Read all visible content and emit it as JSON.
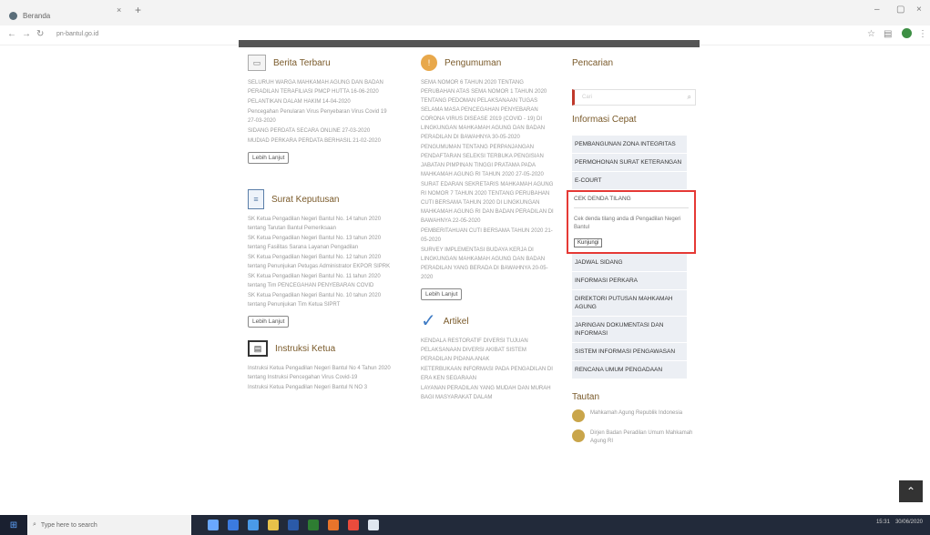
{
  "browser": {
    "tab_title": "Beranda",
    "tab_close": "×",
    "new_tab": "+",
    "url": "pn-bantul.go.id",
    "win_minimize": "–",
    "win_restore": "▢",
    "win_close": "×"
  },
  "berita": {
    "title": "Berita Terbaru",
    "items": [
      "SELURUH WARGA MAHKAMAH AGUNG DAN BADAN PERADILAN TERAFILIASI PMCP HUTTA 16-06-2020",
      "PELANTIKAN DALAM HAKIM 14-04-2020",
      "Pencegahan Penularan Virus Penyebaran Virus Covid 19 27-03-2020",
      "SIDANG PERDATA SECARA ONLINE 27-03-2020",
      "MUDIAD PERKARA PERDATA BERHASIL 21-02-2020"
    ],
    "more": "Lebih Lanjut"
  },
  "putusan": {
    "title": "Surat Keputusan",
    "items": [
      "SK Ketua Pengadilan Negeri Bantul No. 14 tahun 2020 tentang Tarutan Bantul Pemeriksaan",
      "SK Ketua Pengadilan Negeri Bantul No. 13 tahun 2020 tentang Fasilitas Sarana Layanan Pengadilan",
      "SK Ketua Pengadilan Negeri Bantul No. 12 tahun 2020 tentang Penunjukan Petugas Administrator EKPOR SIPRK",
      "SK Ketua Pengadilan Negeri Bantul No. 11 tahun 2020 tentang Tim PENCEGAHAN PENYEBARAN COVID",
      "SK Ketua Pengadilan Negeri Bantul No. 10 tahun 2020 tentang Penunjukan Tim Ketua SIPRT"
    ],
    "more": "Lebih Lanjut"
  },
  "instruksi": {
    "title": "Instruksi Ketua",
    "items": [
      "Instruksi Ketua Pengadilan Negeri Bantul No 4 Tahun 2020 tentang Instruksi Pencegahan Virus Covid-19",
      "Instruksi Ketua Pengadilan Negeri Bantul N NO 3"
    ]
  },
  "pengumuman": {
    "title": "Pengumuman",
    "items": [
      "SEMA NOMOR 6 TAHUN 2020 TENTANG PERUBAHAN ATAS SEMA NOMOR 1 TAHUN 2020 TENTANG PEDOMAN PELAKSANAAN TUGAS SELAMA MASA PENCEGAHAN PENYEBARAN CORONA VIRUS DISEASE 2019 (COVID - 19) DI LINGKUNGAN MAHKAMAH AGUNG DAN BADAN PERADILAN DI BAWAHNYA 30-05-2020",
      "PENGUMUMAN TENTANG PERPANJANGAN PENDAFTARAN SELEKSI TERBUKA PENGISIAN JABATAN PIMPINAN TINGGI PRATAMA PADA MAHKAMAH AGUNG RI TAHUN 2020 27-05-2020",
      "SURAT EDARAN SEKRETARIS MAHKAMAH AGUNG RI NOMOR 7 TAHUN 2020 TENTANG PERUBAHAN CUTI BERSAMA TAHUN 2020 DI LINGKUNGAN MAHKAMAH AGUNG RI DAN BADAN PERADILAN DI BAWAHNYA 22-05-2020",
      "PEMBERITAHUAN CUTI BERSAMA TAHUN 2020 21-05-2020",
      "SURVEY IMPLEMENTASI BUDAYA KERJA DI LINGKUNGAN MAHKAMAH AGUNG DAN BADAN PERADILAN YANG BERADA DI BAWAHNYA 20-05-2020"
    ],
    "more": "Lebih Lanjut"
  },
  "artikel": {
    "title": "Artikel",
    "items": [
      "KENDALA RESTORATIF DIVERSI TUJUAN PELAKSANAAN DIVERSI AKIBAT SISTEM PERADILAN PIDANA ANAK",
      "KETERBUKAAN INFORMASI PADA PENGADILAN DI ERA KEN SEGARAAN",
      "LAYANAN PERADILAN YANG MUDAH DAN MURAH BAGI MASYARAKAT DALAM"
    ]
  },
  "sidebar": {
    "search_title": "Pencarian",
    "search_placeholder": "Cari",
    "info_title": "Informasi Cepat",
    "items_top": [
      "PEMBANGUNAN ZONA INTEGRITAS",
      "PERMOHONAN SURAT KETERANGAN",
      "E-COURT"
    ],
    "cek": {
      "head": "CEK DENDA TILANG",
      "body": "Cek denda tilang anda di Pengadilan Negeri Bantul",
      "button": "Kunjungi"
    },
    "items_bottom": [
      "JADWAL SIDANG",
      "INFORMASI PERKARA",
      "DIREKTORI PUTUSAN MAHKAMAH AGUNG",
      "JARINGAN DOKUMENTASI DAN INFORMASI",
      "SISTEM INFORMASI PENGAWASAN",
      "RENCANA UMUM PENGADAAN"
    ],
    "tautan_title": "Tautan",
    "tautan": [
      "Mahkamah Agung Republik Indonesia",
      "Dirjen Badan Peradilan Umum Mahkamah Agung RI"
    ]
  },
  "taskbar": {
    "search_placeholder": "Type here to search",
    "time": "15:31",
    "date": "30/06/2020"
  },
  "colors": {
    "accent": "#7a5a2a",
    "highlight": "#e53935"
  }
}
